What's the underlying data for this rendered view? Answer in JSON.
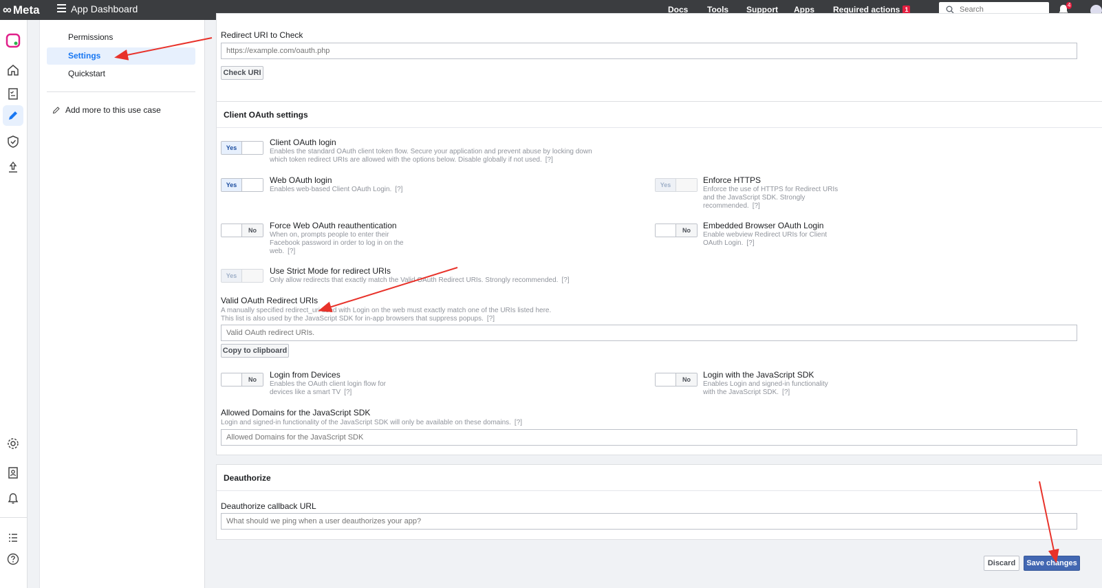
{
  "topbar": {
    "brand": "Meta",
    "app_title": "App Dashboard",
    "nav": [
      "Docs",
      "Tools",
      "Support",
      "Apps"
    ],
    "required_actions": "Required actions",
    "required_actions_count": "1",
    "search_placeholder": "Search",
    "notifications_count": "4"
  },
  "subnav": {
    "items": [
      "Permissions",
      "Settings",
      "Quickstart"
    ],
    "add_more": "Add more to this use case"
  },
  "redirect_check": {
    "label": "Redirect URI to Check",
    "placeholder": "https://example.com/oauth.php",
    "button": "Check URI"
  },
  "client_oauth": {
    "header": "Client OAuth settings",
    "client_login": {
      "title": "Client OAuth login",
      "desc1": "Enables the standard OAuth client token flow. Secure your application and prevent abuse by locking down",
      "desc2": "which token redirect URIs are allowed with the options below. Disable globally if not used.",
      "state": "Yes"
    },
    "web_login": {
      "title": "Web OAuth login",
      "desc1": "Enables web-based Client OAuth Login.",
      "state": "Yes"
    },
    "enforce_https": {
      "title": "Enforce HTTPS",
      "desc1": "Enforce the use of HTTPS for Redirect URIs",
      "desc2": "and the JavaScript SDK. Strongly",
      "desc3": "recommended.",
      "state": "Yes"
    },
    "force_reauth": {
      "title": "Force Web OAuth reauthentication",
      "desc1": "When on, prompts people to enter their",
      "desc2": "Facebook password in order to log in on the",
      "desc3": "web.",
      "state": "No"
    },
    "embedded_browser": {
      "title": "Embedded Browser OAuth Login",
      "desc1": "Enable webview Redirect URIs for Client",
      "desc2": "OAuth Login.",
      "state": "No"
    },
    "strict_mode": {
      "title": "Use Strict Mode for redirect URIs",
      "desc1": "Only allow redirects that exactly match the Valid OAuth Redirect URIs. Strongly recommended.",
      "state": "Yes"
    },
    "valid_redirect": {
      "title": "Valid OAuth Redirect URIs",
      "desc1": "A manually specified redirect_uri used with Login on the web must exactly match one of the URIs listed here.",
      "desc2": "This list is also used by the JavaScript SDK for in-app browsers that suppress popups.",
      "placeholder": "Valid OAuth redirect URIs.",
      "copy_button": "Copy to clipboard"
    },
    "login_devices": {
      "title": "Login from Devices",
      "desc1": "Enables the OAuth client login flow for",
      "desc2": "devices like a smart TV",
      "state": "No"
    },
    "login_js": {
      "title": "Login with the JavaScript SDK",
      "desc1": "Enables Login and signed-in functionality",
      "desc2": "with the JavaScript SDK.",
      "state": "No"
    },
    "allowed_domains": {
      "title": "Allowed Domains for the JavaScript SDK",
      "desc1": "Login and signed-in functionality of the JavaScript SDK will only be available on these domains.",
      "placeholder": "Allowed Domains for the JavaScript SDK"
    },
    "help_mark": "[?]"
  },
  "deauthorize": {
    "header": "Deauthorize",
    "label": "Deauthorize callback URL",
    "placeholder": "What should we ping when a user deauthorizes your app?"
  },
  "footer": {
    "discard": "Discard",
    "save": "Save changes"
  },
  "colors": {
    "accent": "#1877f2",
    "save_button": "#4267b2",
    "annotation_arrow": "#e8322a"
  }
}
